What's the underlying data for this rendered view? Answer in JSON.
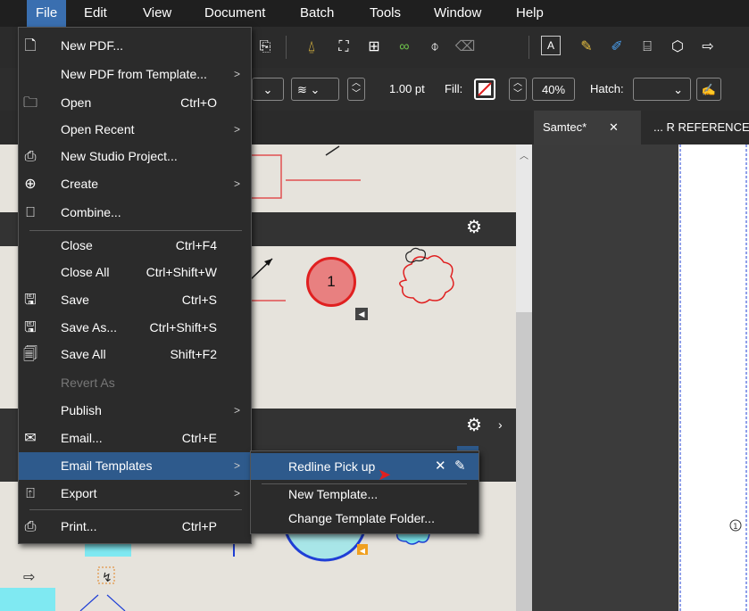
{
  "menubar": {
    "items": [
      "File",
      "Edit",
      "View",
      "Document",
      "Batch",
      "Tools",
      "Window",
      "Help"
    ]
  },
  "toolbar": {
    "line_width": "1.00 pt",
    "fill_label": "Fill:",
    "opacity": "40%",
    "hatch_label": "Hatch:"
  },
  "tabs": [
    {
      "label": "Samtec*",
      "close": "✕"
    },
    {
      "label": "... R REFERENCE P"
    }
  ],
  "canvas": {
    "circle_number": "1"
  },
  "file_menu": {
    "items": [
      {
        "label": "New PDF...",
        "shortcut": "",
        "icon": "new-pdf-icon"
      },
      {
        "label": "New PDF from Template...",
        "shortcut": "",
        "icon": ""
      },
      {
        "label": "Open",
        "shortcut": "Ctrl+O",
        "icon": "open-folder-icon"
      },
      {
        "label": "Open Recent",
        "shortcut": "",
        "icon": ""
      },
      {
        "label": "New Studio Project...",
        "shortcut": "",
        "icon": "studio-project-icon"
      },
      {
        "label": "Create",
        "shortcut": "",
        "icon": "create-plus-icon"
      },
      {
        "label": "Combine...",
        "shortcut": "",
        "icon": "combine-icon"
      },
      {
        "label": "Close",
        "shortcut": "Ctrl+F4",
        "icon": ""
      },
      {
        "label": "Close All",
        "shortcut": "Ctrl+Shift+W",
        "icon": ""
      },
      {
        "label": "Save",
        "shortcut": "Ctrl+S",
        "icon": "save-icon"
      },
      {
        "label": "Save As...",
        "shortcut": "Ctrl+Shift+S",
        "icon": "save-as-icon"
      },
      {
        "label": "Save All",
        "shortcut": "Shift+F2",
        "icon": "save-all-icon"
      },
      {
        "label": "Revert As",
        "shortcut": "",
        "icon": ""
      },
      {
        "label": "Publish",
        "shortcut": "",
        "icon": ""
      },
      {
        "label": "Email...",
        "shortcut": "Ctrl+E",
        "icon": "email-icon"
      },
      {
        "label": "Email Templates",
        "shortcut": "",
        "icon": ""
      },
      {
        "label": "Export",
        "shortcut": "",
        "icon": "export-icon"
      },
      {
        "label": "Print...",
        "shortcut": "Ctrl+P",
        "icon": "print-icon"
      }
    ]
  },
  "submenu": {
    "items": [
      {
        "label": "Redline Pick up"
      },
      {
        "label": "New Template..."
      },
      {
        "label": "Change Template Folder..."
      }
    ]
  },
  "colors": {
    "accent": "#3a6fb0",
    "menu_bg": "#2b2b2b",
    "highlight": "#2e5a8c",
    "markup_red": "#e02020",
    "markup_blue": "#1f3fd6"
  }
}
